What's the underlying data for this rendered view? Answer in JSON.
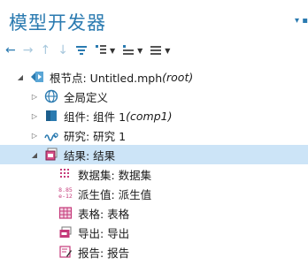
{
  "panel": {
    "title": "模型开发器",
    "controls": "▾ ▪"
  },
  "toolbar": {
    "buttons": [
      {
        "name": "back-arrow-icon",
        "glyph": "←"
      },
      {
        "name": "forward-arrow-icon",
        "glyph": "→"
      },
      {
        "name": "up-arrow-icon",
        "glyph": "↑"
      },
      {
        "name": "down-arrow-icon",
        "glyph": "↓"
      }
    ],
    "dropdown_caret": "▼"
  },
  "tree": {
    "root": {
      "label": "根节点: Untitled.mph ",
      "tag": "(root)"
    },
    "global": {
      "label": "全局定义"
    },
    "component": {
      "label": "组件: 组件 1 ",
      "tag": "(comp1)"
    },
    "study": {
      "label": "研究: 研究 1"
    },
    "results": {
      "label": "结果: 结果"
    },
    "datasets": {
      "label": "数据集: 数据集"
    },
    "derived": {
      "label": "派生值: 派生值",
      "icon_text_top": "8.85",
      "icon_text_bottom": "e-12"
    },
    "tables": {
      "label": "表格: 表格"
    },
    "export": {
      "label": "导出: 导出"
    },
    "report": {
      "label": "报告: 报告"
    }
  },
  "colors": {
    "accent": "#2a7ab0",
    "selection": "#cce4f7"
  }
}
